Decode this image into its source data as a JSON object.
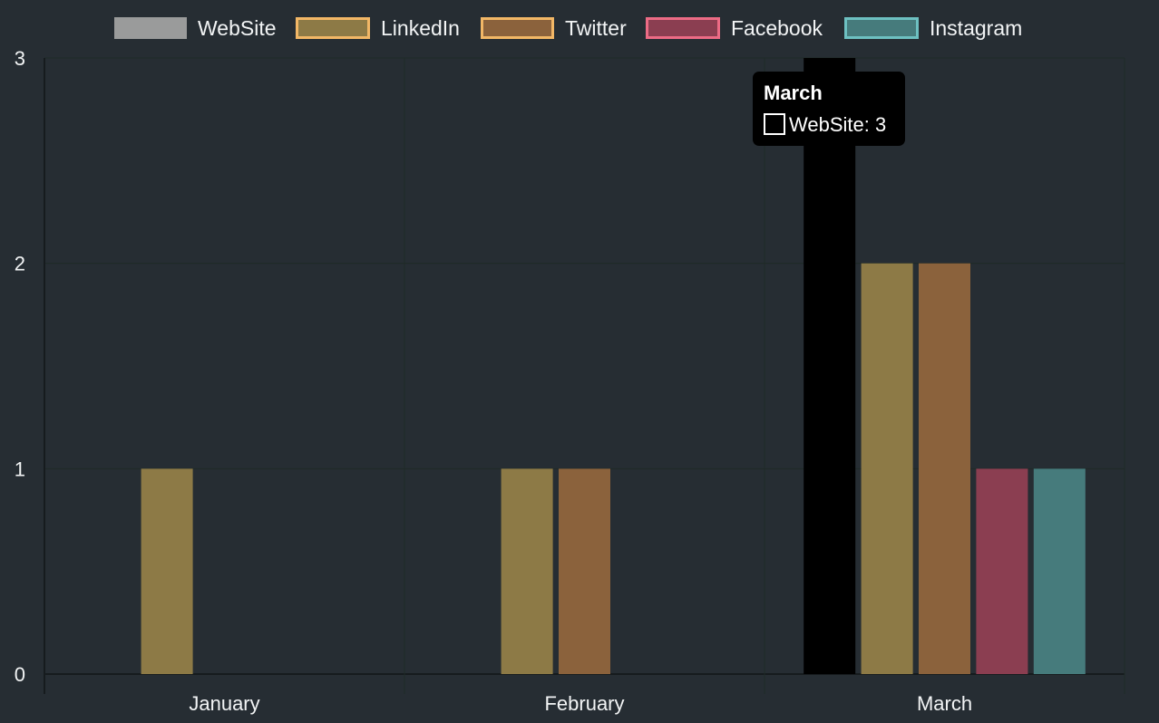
{
  "chart_data": {
    "type": "bar",
    "categories": [
      "January",
      "February",
      "March"
    ],
    "series": [
      {
        "name": "WebSite",
        "values": [
          0,
          0,
          3
        ],
        "fill": "#9a9b9b",
        "border": "#9a9b9b"
      },
      {
        "name": "LinkedIn",
        "values": [
          1,
          1,
          2
        ],
        "fill": "#8d7a46",
        "border": "#f2b766"
      },
      {
        "name": "Twitter",
        "values": [
          0,
          1,
          2
        ],
        "fill": "#8b623c",
        "border": "#f2b766"
      },
      {
        "name": "Facebook",
        "values": [
          0,
          0,
          1
        ],
        "fill": "#8b3e51",
        "border": "#ec6b85"
      },
      {
        "name": "Instagram",
        "values": [
          0,
          0,
          1
        ],
        "fill": "#467b7c",
        "border": "#6dc0c1"
      }
    ],
    "ylim": [
      0,
      3
    ],
    "yticks": [
      0,
      1,
      2,
      3
    ],
    "grid": true,
    "legend_position": "top",
    "hovered": {
      "series": "WebSite",
      "category": "March",
      "highlight_fill": "#000000"
    },
    "tooltip": {
      "title": "March",
      "body": "WebSite: 3"
    },
    "colors": {
      "background": "#262d33",
      "grid": "#1f2a27",
      "axis": "#161b1e",
      "text": "#f2f4f5"
    }
  }
}
